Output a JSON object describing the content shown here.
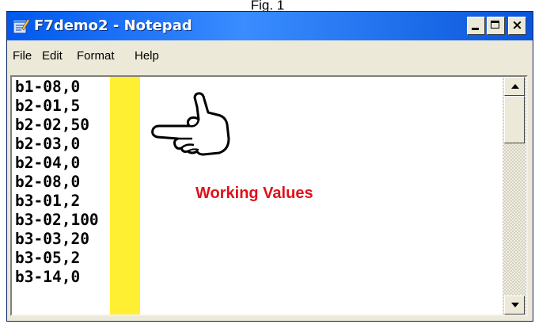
{
  "caption": "Fig. 1",
  "window": {
    "title": "F7demo2 - Notepad",
    "title_color": "#0058ee"
  },
  "icons": {
    "app": "notepad-icon",
    "minimize": "minimize-icon",
    "maximize": "maximize-icon",
    "close": "close-icon",
    "pointer": "pointing-hand-icon",
    "scroll_up": "scroll-up-arrow-icon",
    "scroll_down": "scroll-down-arrow-icon"
  },
  "controls": {
    "close_glyph": "×"
  },
  "menu": {
    "items": [
      "File",
      "Edit",
      "Format",
      "Help"
    ]
  },
  "editor": {
    "highlight_color": "#ffef33",
    "lines": [
      {
        "key": "b1-08,",
        "value": "0"
      },
      {
        "key": "b2-01,",
        "value": "5"
      },
      {
        "key": "b2-02,",
        "value": "50"
      },
      {
        "key": "b2-03,",
        "value": "0"
      },
      {
        "key": "b2-04,",
        "value": "0"
      },
      {
        "key": "b2-08,",
        "value": "0"
      },
      {
        "key": "b3-01,",
        "value": "2"
      },
      {
        "key": "b3-02,",
        "value": "100"
      },
      {
        "key": "b3-03,",
        "value": "20"
      },
      {
        "key": "b3-05,",
        "value": "2"
      },
      {
        "key": "b3-14,",
        "value": "0"
      }
    ]
  },
  "annotation": {
    "text": "Working Values",
    "color": "#e0101a"
  }
}
